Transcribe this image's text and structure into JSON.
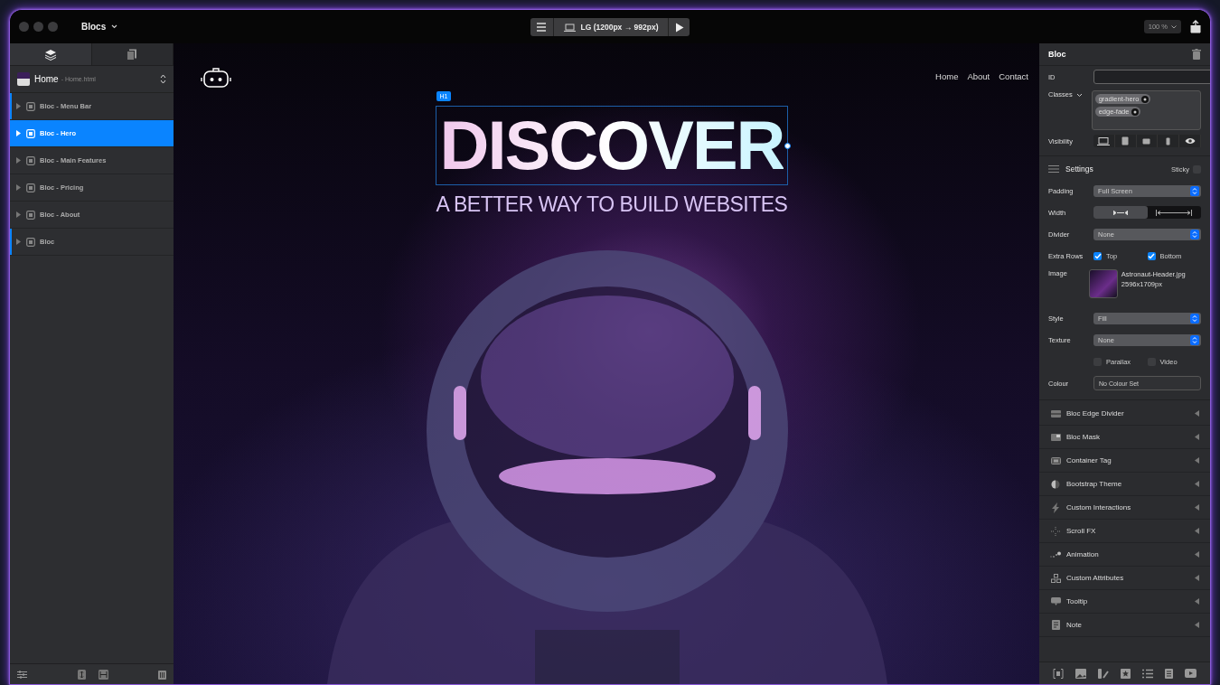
{
  "window": {
    "title": "Blocs"
  },
  "toolbar": {
    "breakpoint": "LG (1200px → 992px)",
    "zoom": "100 %"
  },
  "sidebar": {
    "page": {
      "name": "Home",
      "file": "- Home.html"
    },
    "items": [
      {
        "label": "Bloc - Menu Bar",
        "selected": false,
        "flagged": true
      },
      {
        "label": "Bloc - Hero",
        "selected": true,
        "flagged": false
      },
      {
        "label": "Bloc - Main Features",
        "selected": false,
        "flagged": false
      },
      {
        "label": "Bloc - Pricing",
        "selected": false,
        "flagged": false
      },
      {
        "label": "Bloc - About",
        "selected": false,
        "flagged": false
      },
      {
        "label": "Bloc",
        "selected": false,
        "flagged": true
      }
    ]
  },
  "canvas": {
    "nav": [
      "Home",
      "About",
      "Contact"
    ],
    "tag": "H1",
    "heading": "DISCOVER",
    "subheading": "A BETTER WAY TO BUILD WEBSITES"
  },
  "inspector": {
    "title": "Bloc",
    "id_label": "ID",
    "classes_label": "Classes",
    "classes": [
      "gradient-hero",
      "edge-fade"
    ],
    "visibility_label": "Visibility",
    "settings_title": "Settings",
    "sticky": {
      "label": "Sticky",
      "checked": false
    },
    "padding": {
      "label": "Padding",
      "value": "Full Screen"
    },
    "width": {
      "label": "Width",
      "options": [
        {
          "kind": "contained",
          "selected": true
        },
        {
          "kind": "full",
          "selected": false
        }
      ]
    },
    "divider": {
      "label": "Divider",
      "value": "None"
    },
    "extra_rows": {
      "label": "Extra Rows",
      "options": [
        {
          "label": "Top",
          "checked": true
        },
        {
          "label": "Bottom",
          "checked": true
        }
      ]
    },
    "image": {
      "label": "Image",
      "file": "Astronaut-Header.jpg",
      "size": "2596x1709px"
    },
    "style": {
      "label": "Style",
      "value": "Fill"
    },
    "texture": {
      "label": "Texture",
      "value": "None"
    },
    "toggles": [
      {
        "label": "Parallax",
        "checked": false
      },
      {
        "label": "Video",
        "checked": false
      }
    ],
    "colour": {
      "label": "Colour",
      "value": "No Colour Set"
    },
    "sections": [
      {
        "label": "Bloc Edge Divider",
        "kind": "edge"
      },
      {
        "label": "Bloc Mask",
        "kind": "mask"
      },
      {
        "label": "Container Tag",
        "kind": "container"
      },
      {
        "label": "Bootstrap Theme",
        "kind": "theme"
      },
      {
        "label": "Custom Interactions",
        "kind": "bolt"
      },
      {
        "label": "Scroll FX",
        "kind": "scroll"
      },
      {
        "label": "Animation",
        "kind": "animation"
      },
      {
        "label": "Custom Attributes",
        "kind": "attributes"
      },
      {
        "label": "Tooltip",
        "kind": "tooltip"
      },
      {
        "label": "Note",
        "kind": "note"
      }
    ]
  }
}
